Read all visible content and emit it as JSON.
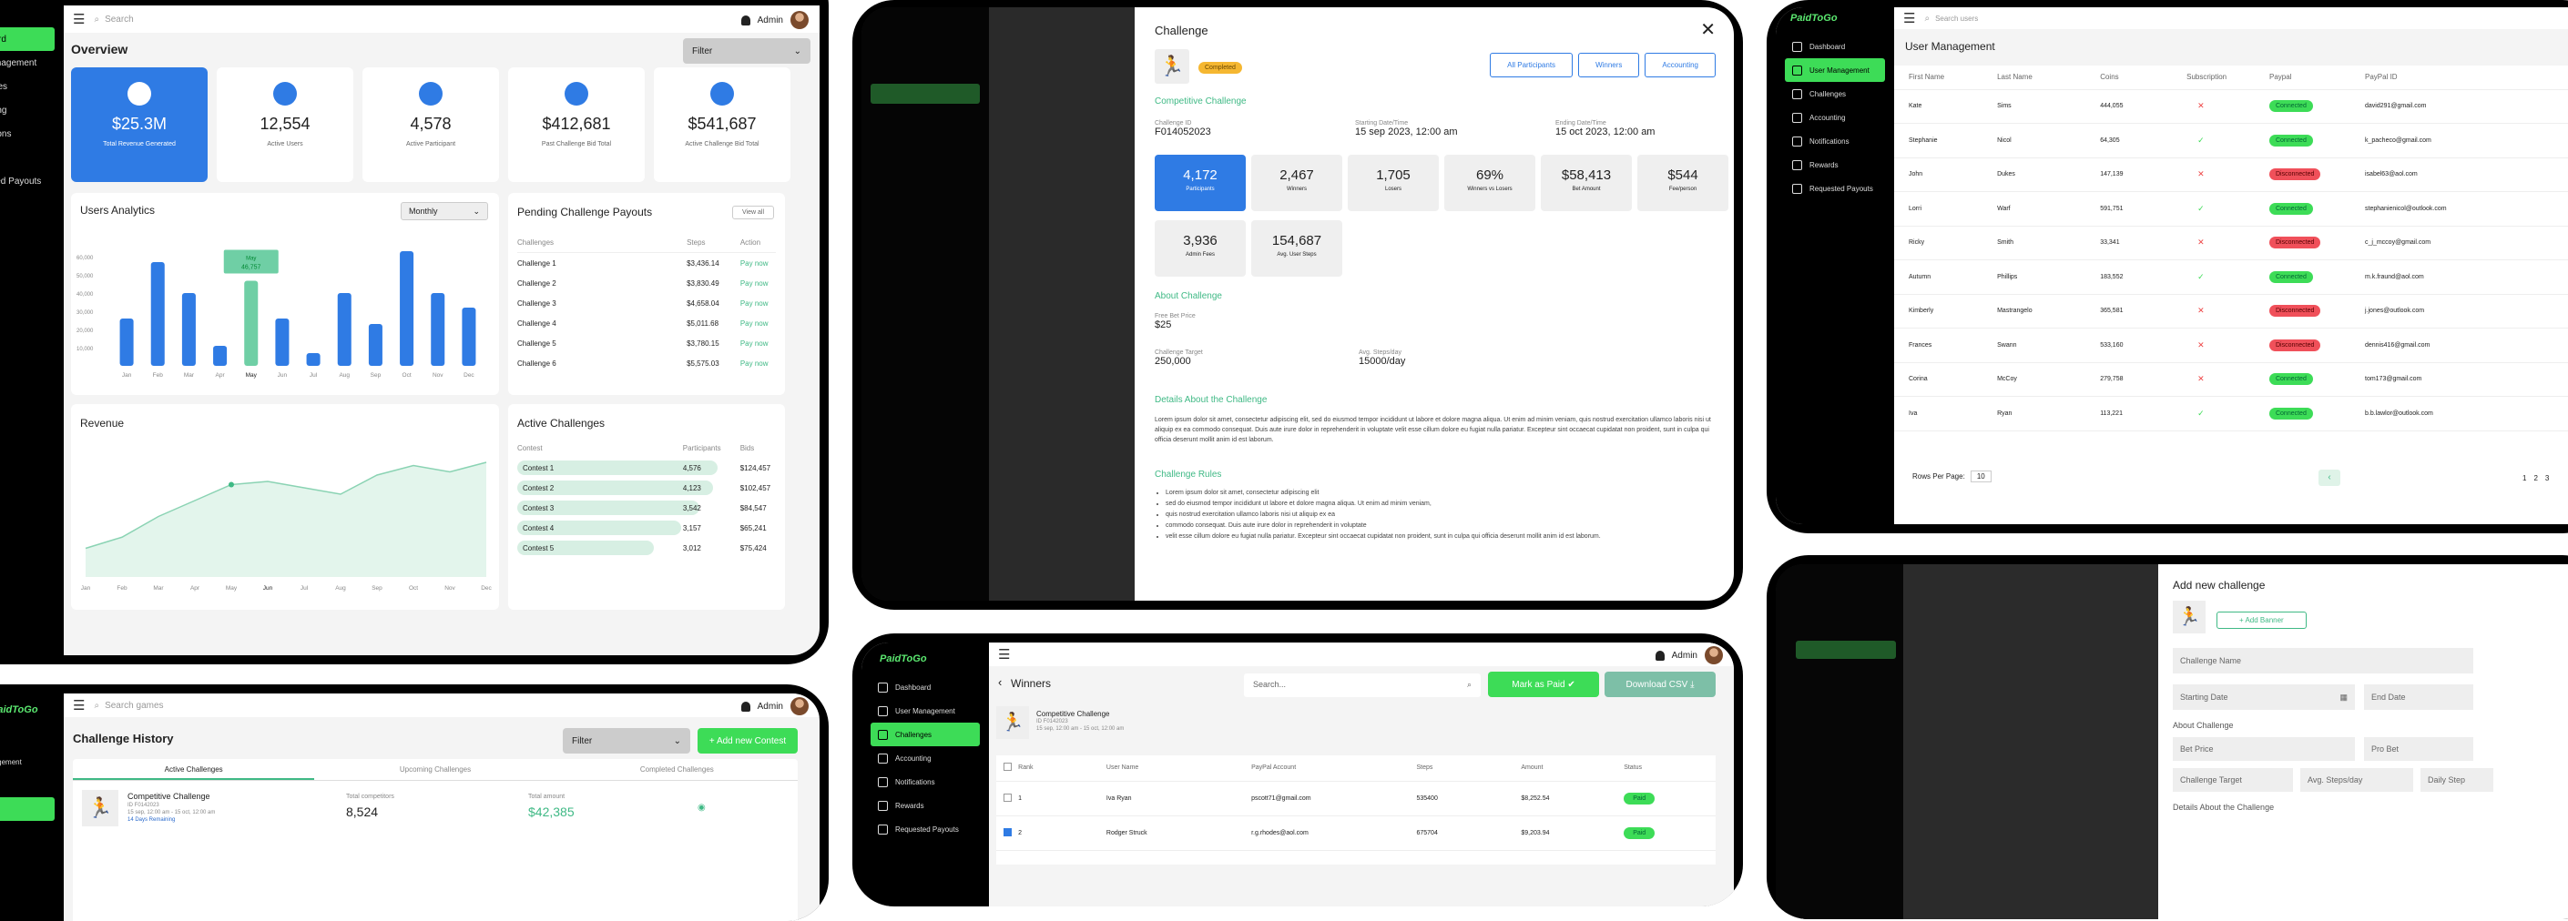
{
  "brand": "PaidToGo",
  "admin": "Admin",
  "search": "Search",
  "search_users": "Search users",
  "search_games": "Search games",
  "sidebar": [
    "Dashboard",
    "User Management",
    "Challenges",
    "Accounting",
    "Notifications",
    "Rewards",
    "Requested Payouts"
  ],
  "overview": {
    "title": "Overview",
    "filter": "Filter",
    "stats": [
      {
        "value": "$25.3M",
        "label": "Total Revenue Generated"
      },
      {
        "value": "12,554",
        "label": "Active Users"
      },
      {
        "value": "4,578",
        "label": "Active Participant"
      },
      {
        "value": "$412,681",
        "label": "Past Challenge Bid Total"
      },
      {
        "value": "$541,687",
        "label": "Active Challenge Bid Total"
      }
    ],
    "analytics_title": "Users Analytics",
    "period": "Monthly",
    "tooltip_month": "May",
    "tooltip_value": "46,757",
    "payouts_title": "Pending Challenge Payouts",
    "view_all": "View all",
    "payout_cols": [
      "Challenges",
      "Steps",
      "Action"
    ],
    "payouts": [
      {
        "name": "Challenge 1",
        "steps": "$3,436.14"
      },
      {
        "name": "Challenge 2",
        "steps": "$3,830.49"
      },
      {
        "name": "Challenge 3",
        "steps": "$4,658.04"
      },
      {
        "name": "Challenge 4",
        "steps": "$5,011.68"
      },
      {
        "name": "Challenge 5",
        "steps": "$3,780.15"
      },
      {
        "name": "Challenge 6",
        "steps": "$5,575.03"
      }
    ],
    "pay_now": "Pay now",
    "revenue_title": "Revenue",
    "active_title": "Active Challenges",
    "active_cols": [
      "Contest",
      "Participants",
      "Bids"
    ],
    "active": [
      {
        "name": "Contest 1",
        "p": "4,576",
        "b": "$124,457"
      },
      {
        "name": "Contest 2",
        "p": "4,123",
        "b": "$102,457"
      },
      {
        "name": "Contest 3",
        "p": "3,542",
        "b": "$84,547"
      },
      {
        "name": "Contest 4",
        "p": "3,157",
        "b": "$65,241"
      },
      {
        "name": "Contest 5",
        "p": "3,012",
        "b": "$75,424"
      }
    ]
  },
  "chart_data": [
    {
      "type": "bar",
      "title": "Users Analytics",
      "categories": [
        "Jan",
        "Feb",
        "Mar",
        "Apr",
        "May",
        "Jun",
        "Jul",
        "Aug",
        "Sep",
        "Oct",
        "Nov",
        "Dec"
      ],
      "values": [
        26000,
        57000,
        40000,
        11000,
        46757,
        26000,
        7000,
        40000,
        23000,
        63000,
        40000,
        32000
      ],
      "ylim": [
        0,
        60000
      ],
      "yticks": [
        "10,000",
        "20,000",
        "30,000",
        "40,000",
        "50,000",
        "60,000"
      ]
    },
    {
      "type": "area",
      "title": "Revenue",
      "categories": [
        "Jan",
        "Feb",
        "Mar",
        "Apr",
        "May",
        "Jun",
        "Jul",
        "Aug",
        "Sep",
        "Oct",
        "Nov",
        "Dec"
      ],
      "values": [
        18,
        25,
        38,
        48,
        58,
        60,
        56,
        52,
        64,
        70,
        66,
        72
      ]
    }
  ],
  "challenge": {
    "title": "Challenge",
    "status": "Completed",
    "actions": [
      "All Participants",
      "Winners",
      "Accounting"
    ],
    "name": "Competitive Challenge",
    "id_label": "Challenge ID",
    "id": "F014052023",
    "start_label": "Starting Date/Time",
    "start": "15 sep 2023, 12:00 am",
    "end_label": "Ending Date/Time",
    "end": "15 oct 2023, 12:00 am",
    "stats": [
      {
        "v": "4,172",
        "l": "Participants"
      },
      {
        "v": "2,467",
        "l": "Winners"
      },
      {
        "v": "1,705",
        "l": "Losers"
      },
      {
        "v": "69%",
        "l": "Winners vs Losers"
      },
      {
        "v": "$58,413",
        "l": "Bet Amount"
      },
      {
        "v": "$544",
        "l": "Fee/person"
      },
      {
        "v": "3,936",
        "l": "Admin Fees"
      },
      {
        "v": "154,687",
        "l": "Avg. User Steps"
      }
    ],
    "about": "About Challenge",
    "free_bet_label": "Free Bet Price",
    "free_bet": "$25",
    "target_label": "Challenge Target",
    "target": "250,000",
    "avg_label": "Avg. Steps/day",
    "avg": "15000/day",
    "details": "Details About the Challenge",
    "details_text": "Lorem ipsum dolor sit amet, consectetur adipiscing elit, sed do eiusmod tempor incididunt ut labore et dolore magna aliqua. Ut enim ad minim veniam, quis nostrud exercitation ullamco laboris nisi ut aliquip ex ea commodo consequat. Duis aute irure dolor in reprehenderit in voluptate velit esse cillum dolore eu fugiat nulla pariatur. Excepteur sint occaecat cupidatat non proident, sunt in culpa qui officia deserunt mollit anim id est laborum.",
    "rules": "Challenge Rules",
    "rules_list": [
      "Lorem ipsum dolor sit amet, consectetur adipiscing elit",
      "sed do eiusmod tempor incididunt ut labore et dolore magna aliqua. Ut enim ad minim veniam,",
      "quis nostrud exercitation ullamco laboris nisi ut aliquip ex ea",
      "commodo consequat. Duis aute irure dolor in reprehenderit in voluptate",
      "velit esse cillum dolore eu fugiat nulla pariatur. Excepteur sint occaecat cupidatat non proident, sunt in culpa qui officia deserunt mollit anim id est laborum."
    ]
  },
  "users": {
    "title": "User Management",
    "cols": [
      "First Name",
      "Last Name",
      "Coins",
      "Subscription",
      "Paypal",
      "PayPal ID"
    ],
    "rows": [
      [
        "Kate",
        "Sims",
        "444,055",
        "x",
        "Connected",
        "david291@gmail.com"
      ],
      [
        "Stephanie",
        "Nicol",
        "64,305",
        "v",
        "Connected",
        "k_pacheco@gmail.com"
      ],
      [
        "John",
        "Dukes",
        "147,139",
        "x",
        "Disconnected",
        "isabel63@aol.com"
      ],
      [
        "Lorri",
        "Warf",
        "591,751",
        "v",
        "Connected",
        "stephanienicol@outlook.com"
      ],
      [
        "Ricky",
        "Smith",
        "33,341",
        "x",
        "Disconnected",
        "c_j_mccoy@gmail.com"
      ],
      [
        "Autumn",
        "Phillips",
        "183,552",
        "v",
        "Connected",
        "m.k.fraund@aol.com"
      ],
      [
        "Kimberly",
        "Mastrangelo",
        "365,581",
        "x",
        "Disconnected",
        "j.jones@outlook.com"
      ],
      [
        "Frances",
        "Swann",
        "533,160",
        "x",
        "Disconnected",
        "dennis416@gmail.com"
      ],
      [
        "Corina",
        "McCoy",
        "279,758",
        "x",
        "Connected",
        "tom173@gmail.com"
      ],
      [
        "Iva",
        "Ryan",
        "113,221",
        "v",
        "Connected",
        "b.b.lawlor@outlook.com"
      ]
    ],
    "rows_per_page": "Rows Per Page:",
    "rpp": "10",
    "pages": [
      "1",
      "2",
      "3"
    ]
  },
  "history": {
    "title": "Challenge History",
    "filter": "Filter",
    "add": "+ Add new Contest",
    "tabs": [
      "Active Challenges",
      "Upcoming Challenges",
      "Completed Challenges"
    ],
    "item": "Competitive Challenge",
    "item_id": "ID F0142023",
    "item_dates": "15 sep, 12:00 am - 15 oct, 12:00 am",
    "item_remaining": "14 Days Remaining",
    "comp_label": "Total competitors",
    "comp": "8,524",
    "amt_label": "Total amount",
    "amt": "$42,385"
  },
  "winners": {
    "title": "Winners",
    "search": "Search...",
    "mark": "Mark as Paid",
    "csv": "Download CSV",
    "challenge": "Competitive Challenge",
    "cid": "ID F0142023",
    "dates": "15 sep, 12:00 am - 15 oct, 12:00 am",
    "cols": [
      "Rank",
      "User Name",
      "PayPal Account",
      "Steps",
      "Amount",
      "Status"
    ],
    "rows": [
      {
        "rank": "1",
        "name": "Iva Ryan",
        "pp": "pscott71@gmail.com",
        "steps": "535400",
        "amt": "$8,252.54",
        "status": "Paid",
        "checked": false
      },
      {
        "rank": "2",
        "name": "Rodger Struck",
        "pp": "r.g.rhodes@aol.com",
        "steps": "675704",
        "amt": "$9,203.94",
        "status": "Paid",
        "checked": true
      }
    ]
  },
  "add": {
    "title": "Add new challenge",
    "banner": "+ Add Banner",
    "name": "Challenge Name",
    "start": "Starting Date",
    "end": "End Date",
    "about": "About Challenge",
    "bet": "Bet Price",
    "pro": "Pro Bet",
    "target": "Challenge Target",
    "avg": "Avg. Steps/day",
    "daily": "Daily Step",
    "details": "Details About the Challenge"
  }
}
